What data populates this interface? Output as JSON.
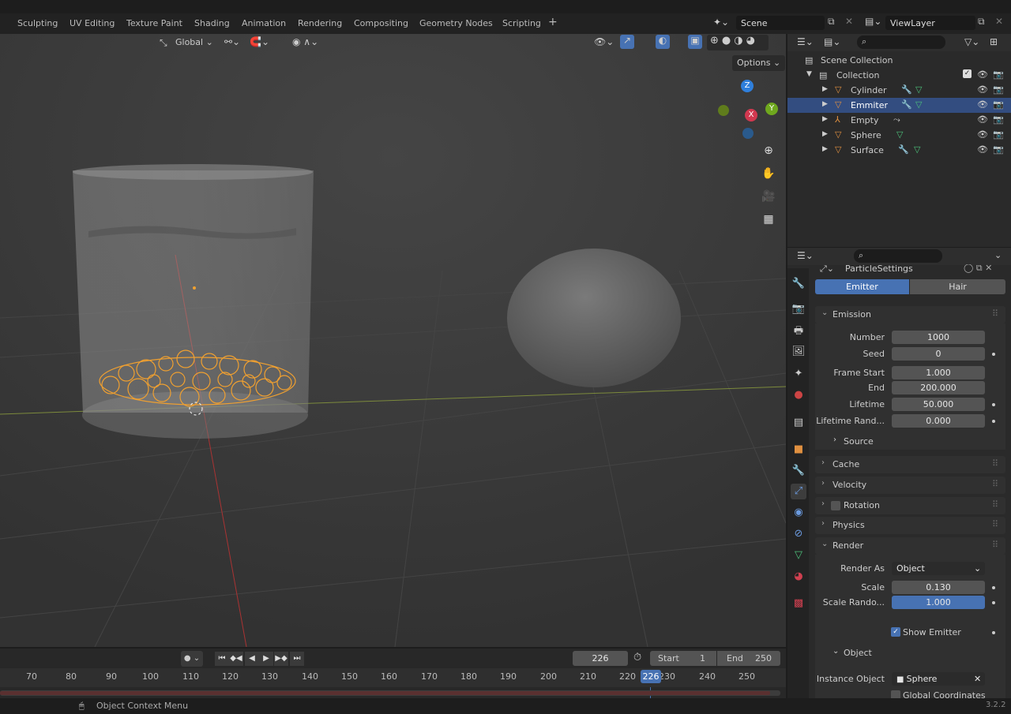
{
  "workspaces": [
    "Sculpting",
    "UV Editing",
    "Texture Paint",
    "Shading",
    "Animation",
    "Rendering",
    "Compositing",
    "Geometry Nodes",
    "Scripting"
  ],
  "add_tab": "+",
  "scene": {
    "label": "Scene",
    "viewlayer": "ViewLayer"
  },
  "viewport": {
    "orientation": "Global",
    "options": "Options",
    "gizmo": {
      "z": "Z",
      "y": "Y",
      "x": "X"
    }
  },
  "outliner": {
    "root": "Scene Collection",
    "collection": "Collection",
    "items": [
      {
        "label": "Cylinder",
        "selected": false
      },
      {
        "label": "Emmiter",
        "selected": true
      },
      {
        "label": "Empty",
        "selected": false
      },
      {
        "label": "Sphere",
        "selected": false
      },
      {
        "label": "Surface",
        "selected": false
      }
    ]
  },
  "properties": {
    "settings_name": "ParticleSettings",
    "type_tabs": [
      "Emitter",
      "Hair"
    ],
    "emission_title": "Emission",
    "number_label": "Number",
    "number": "1000",
    "seed_label": "Seed",
    "seed": "0",
    "frame_start_label": "Frame Start",
    "frame_start": "1.000",
    "end_label": "End",
    "end": "200.000",
    "lifetime_label": "Lifetime",
    "lifetime": "50.000",
    "lifetime_rand_label": "Lifetime Rand...",
    "lifetime_rand": "0.000",
    "source": "Source",
    "cache": "Cache",
    "velocity": "Velocity",
    "rotation": "Rotation",
    "physics": "Physics",
    "render_title": "Render",
    "render_as_label": "Render As",
    "render_as": "Object",
    "scale_label": "Scale",
    "scale": "0.130",
    "scale_rand_label": "Scale Rando...",
    "scale_rand": "1.000",
    "show_emitter": "Show Emitter",
    "object_sub": "Object",
    "instance_label": "Instance Object",
    "instance": "Sphere",
    "global_coords": "Global Coordinates"
  },
  "timeline": {
    "current": "226",
    "start_label": "Start",
    "start": "1",
    "end_label": "End",
    "end": "250",
    "ticks": [
      "70",
      "80",
      "90",
      "100",
      "110",
      "120",
      "130",
      "140",
      "150",
      "160",
      "170",
      "180",
      "190",
      "200",
      "210",
      "220",
      "230",
      "240",
      "250"
    ],
    "playhead": "226"
  },
  "status": {
    "context": "Object Context Menu",
    "version": "3.2.2"
  }
}
